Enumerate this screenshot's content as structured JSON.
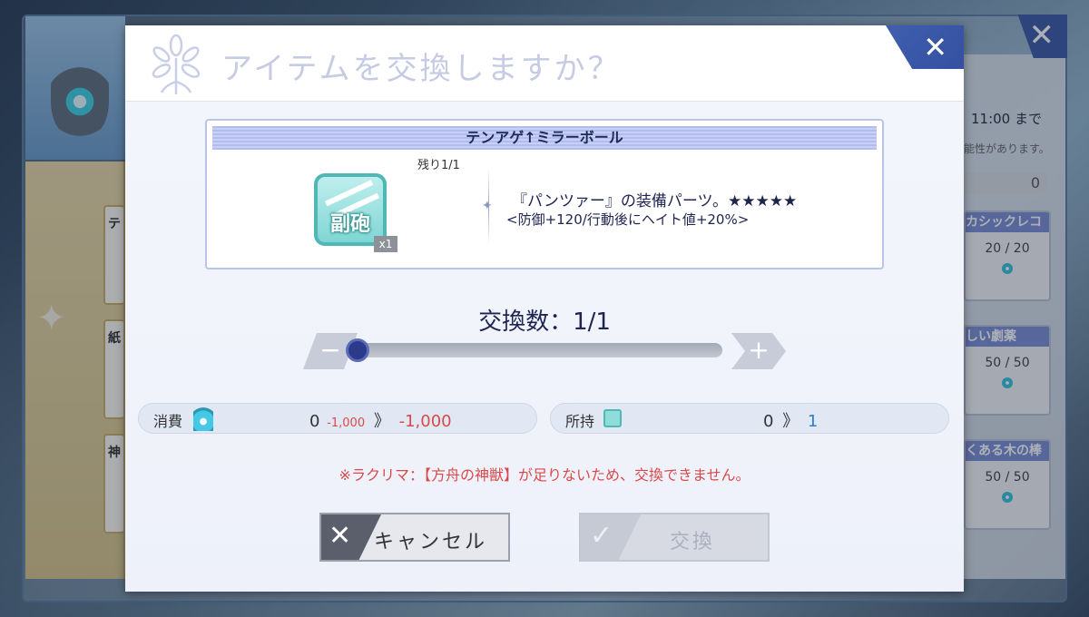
{
  "background": {
    "left_cards": [
      "テ",
      "紙",
      "神"
    ],
    "right_deadline": "11:00 まで",
    "right_note": "能性があります。",
    "right_count": "0",
    "right_cards": [
      {
        "title": "カシックレコ",
        "stock": "20 / 20"
      },
      {
        "title": "しい劇薬",
        "stock": "50 / 50"
      },
      {
        "title": "くある木の棒",
        "stock": "50 / 50"
      }
    ],
    "close_glyph": "✕"
  },
  "dialog": {
    "title": "アイテムを交換しますか？",
    "close_glyph": "✕",
    "item": {
      "name": "テンアゲ↑ミラーボール",
      "remaining": "残り1/1",
      "icon_label": "副砲",
      "quantity_badge": "x1",
      "description": "『パンツァー』の装備パーツ。★★★★★",
      "stats": "<防御+120/行動後にヘイト値+20%>"
    },
    "exchange_count_label": "交換数：1/1",
    "slider": {
      "min": 0,
      "max": 1,
      "value": 1,
      "minus_glyph": "−",
      "plus_glyph": "+"
    },
    "consume": {
      "label": "消費",
      "icon": "lacrima-gem-icon",
      "before": "0",
      "delta": "-1,000",
      "arrow": "》",
      "after": "-1,000"
    },
    "own": {
      "label": "所持",
      "icon": "sub-cannon-item-icon",
      "before": "0",
      "arrow": "》",
      "after": "1"
    },
    "warning": "※ラクリマ：【方舟の神獣】が足りないため、交換できません。",
    "cancel_label": "キャンセル",
    "cancel_glyph": "✕",
    "exchange_label": "交換",
    "exchange_glyph": "✓",
    "colors": {
      "accent": "#3f5fae",
      "warning": "#d84a4a",
      "owned_after": "#2a7fcf"
    }
  }
}
